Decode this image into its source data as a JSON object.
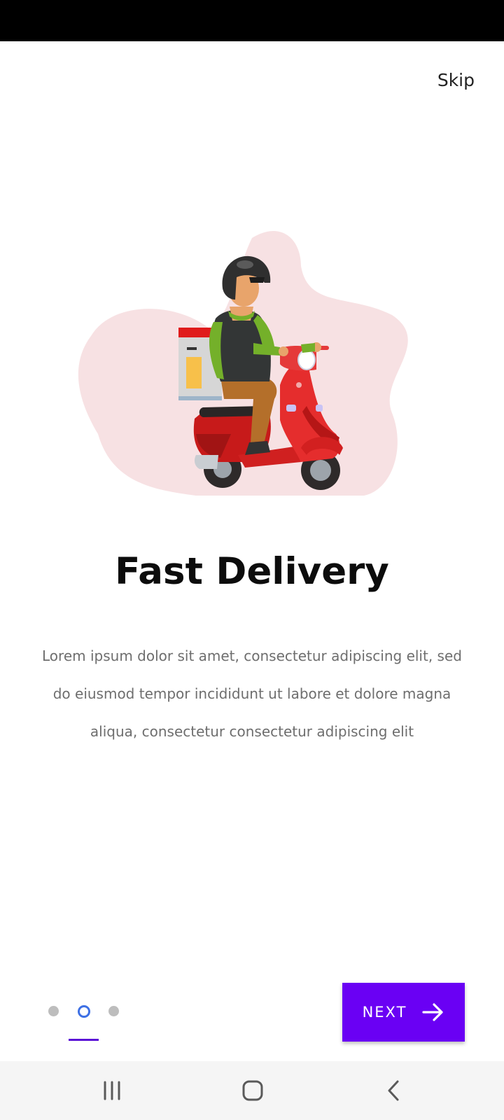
{
  "header": {
    "skip_label": "Skip"
  },
  "onboarding": {
    "title": "Fast Delivery",
    "description": "Lorem ipsum dolor sit amet, consectetur adipiscing elit, sed do eiusmod tempor incididunt ut labore et dolore magna aliqua, consectetur  consectetur adipiscing elit",
    "illustration": "delivery-scooter-rider-illustration"
  },
  "pager": {
    "page_count": 3,
    "current_page": 2
  },
  "footer": {
    "next_label": "NEXT",
    "next_icon": "arrow-right-icon"
  },
  "navigation_bar": {
    "items": [
      "recent-apps-icon",
      "home-icon",
      "back-icon"
    ]
  },
  "colors": {
    "accent": "#6a00f4",
    "indicator_active": "#3e70e4",
    "indicator_inactive": "#bdbdbd",
    "blob": "#f7e1e3"
  }
}
